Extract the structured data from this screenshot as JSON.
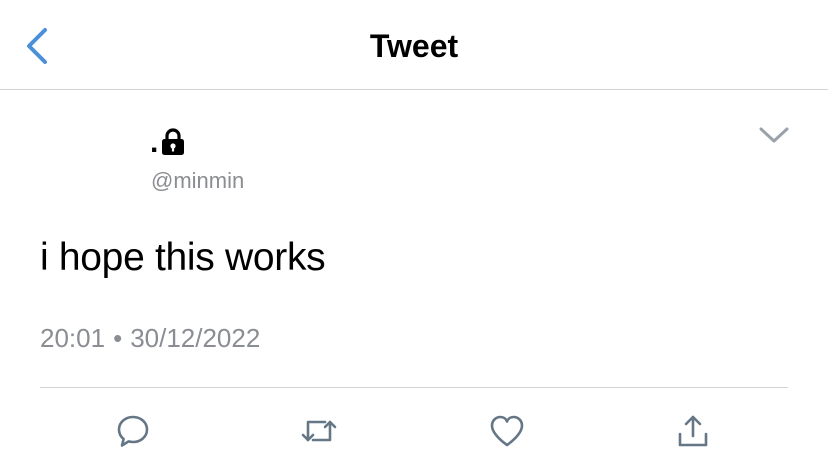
{
  "header": {
    "title": "Tweet",
    "back_icon": "chevron-left-icon",
    "accent_color": "#4a90d9"
  },
  "tweet": {
    "display_name": ".",
    "protected_icon": "lock-icon",
    "handle": "@minmin",
    "text": "i hope this works",
    "time": "20:01",
    "separator": "•",
    "date": "30/12/2022",
    "more_icon": "chevron-down-icon"
  },
  "actions": [
    {
      "name": "reply",
      "icon": "reply-icon"
    },
    {
      "name": "retweet",
      "icon": "retweet-icon"
    },
    {
      "name": "like",
      "icon": "heart-icon"
    },
    {
      "name": "share",
      "icon": "share-icon"
    }
  ],
  "colors": {
    "icon_gray": "#657786",
    "text_secondary": "#8a8d91",
    "divider": "#cfd3d6"
  }
}
